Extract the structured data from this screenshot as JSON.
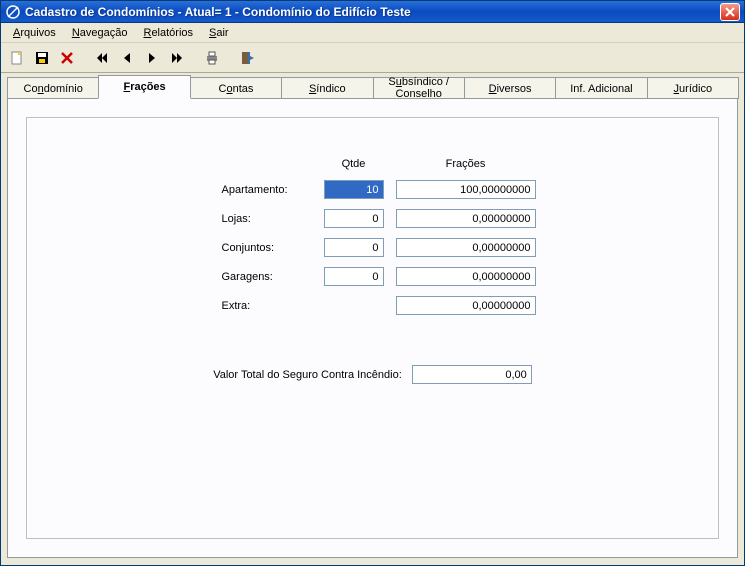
{
  "window": {
    "title": "Cadastro de Condomínios - Atual= 1 - Condomínio do Edifício Teste"
  },
  "menu": {
    "arquivos": "Arquivos",
    "navegacao": "Navegação",
    "relatorios": "Relatórios",
    "sair": "Sair"
  },
  "tabs": {
    "condominio": "Condomínio",
    "fracoes": "Frações",
    "contas": "Contas",
    "sindico": "Síndico",
    "subsindico": "Subsíndico / Conselho",
    "diversos": "Diversos",
    "inf_adicional": "Inf. Adicional",
    "juridico": "Jurídico"
  },
  "form": {
    "headers": {
      "qtde": "Qtde",
      "fracoes": "Frações"
    },
    "rows": {
      "apartamento": {
        "label": "Apartamento:",
        "qtde": "10",
        "fracao": "100,00000000"
      },
      "lojas": {
        "label": "Lojas:",
        "qtde": "0",
        "fracao": "0,00000000"
      },
      "conjuntos": {
        "label": "Conjuntos:",
        "qtde": "0",
        "fracao": "0,00000000"
      },
      "garagens": {
        "label": "Garagens:",
        "qtde": "0",
        "fracao": "0,00000000"
      },
      "extra": {
        "label": "Extra:",
        "fracao": "0,00000000"
      }
    },
    "insurance": {
      "label": "Valor Total do Seguro Contra Incêndio:",
      "value": "0,00"
    }
  }
}
